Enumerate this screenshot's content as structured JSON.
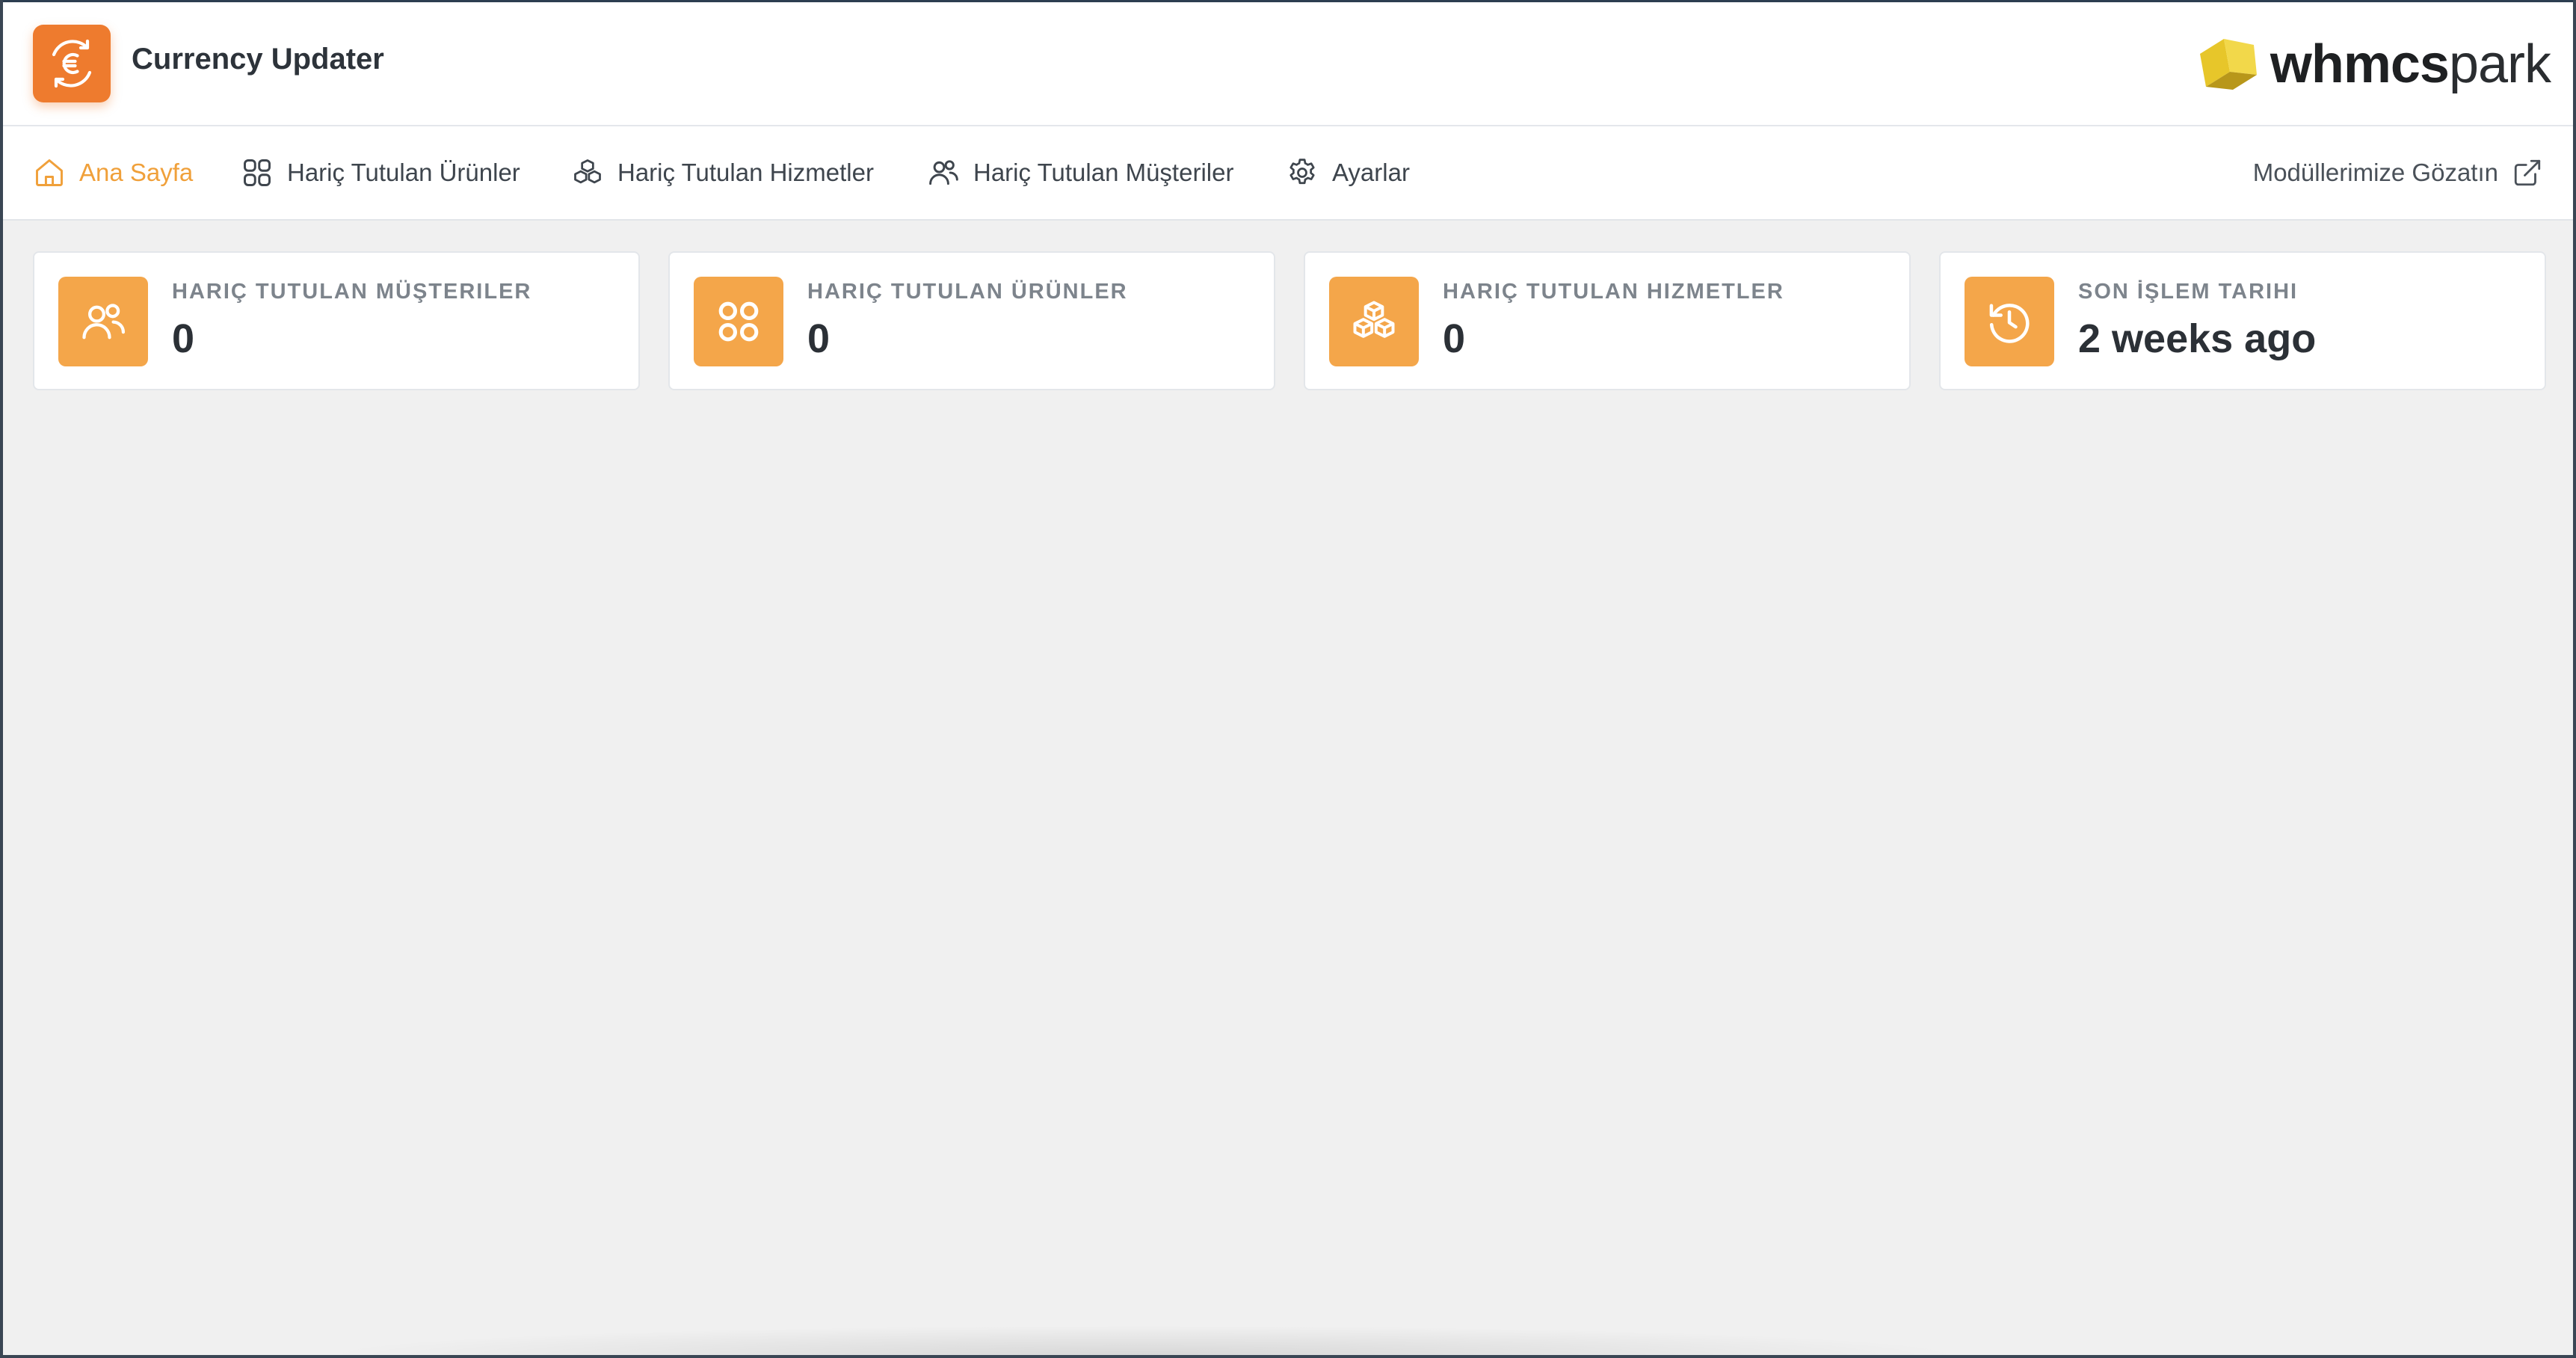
{
  "app": {
    "title": "Currency Updater",
    "logo_icon": "euro-exchange-icon",
    "brand_name_bold": "whmcs",
    "brand_name_light": "park"
  },
  "nav": {
    "items": [
      {
        "label": "Ana Sayfa",
        "icon": "home-icon",
        "active": true
      },
      {
        "label": "Hariç Tutulan Ürünler",
        "icon": "grid-icon",
        "active": false
      },
      {
        "label": "Hariç Tutulan Hizmetler",
        "icon": "cubes-icon",
        "active": false
      },
      {
        "label": "Hariç Tutulan Müşteriler",
        "icon": "users-icon",
        "active": false
      },
      {
        "label": "Ayarlar",
        "icon": "gear-icon",
        "active": false
      }
    ],
    "external_link": {
      "label": "Modüllerimize Gözatın",
      "icon": "external-link-icon"
    }
  },
  "stats": [
    {
      "label": "HARIÇ TUTULAN MÜŞTERILER",
      "value": "0",
      "icon": "users-icon"
    },
    {
      "label": "HARIÇ TUTULAN ÜRÜNLER",
      "value": "0",
      "icon": "grid-icon"
    },
    {
      "label": "HARIÇ TUTULAN HIZMETLER",
      "value": "0",
      "icon": "cubes-icon"
    },
    {
      "label": "SON İŞLEM TARIHI",
      "value": "2 weeks ago",
      "icon": "history-icon"
    }
  ],
  "colors": {
    "accent": "#f4a64a",
    "active_nav": "#f0a03a",
    "logo_bg": "#ee7b2e",
    "background": "#f0f0f0"
  }
}
